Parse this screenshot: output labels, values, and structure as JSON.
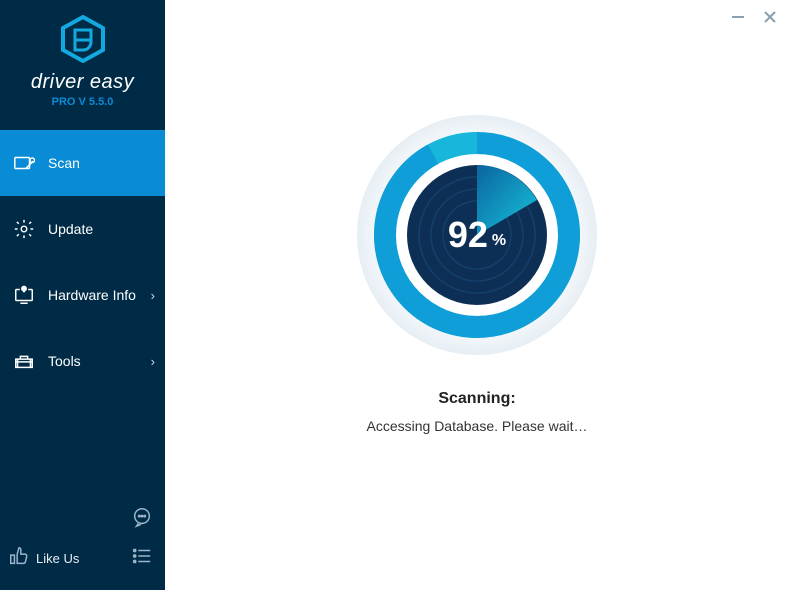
{
  "app": {
    "name": "driver easy",
    "version_label": "PRO V 5.5.0"
  },
  "sidebar": {
    "items": [
      {
        "label": "Scan",
        "has_chevron": false,
        "active": true
      },
      {
        "label": "Update",
        "has_chevron": false,
        "active": false
      },
      {
        "label": "Hardware Info",
        "has_chevron": true,
        "active": false
      },
      {
        "label": "Tools",
        "has_chevron": true,
        "active": false
      }
    ],
    "like_label": "Like Us"
  },
  "scan": {
    "percent_value": "92",
    "percent_symbol": "%",
    "title": "Scanning:",
    "message": "Accessing Database. Please wait…"
  },
  "colors": {
    "sidebar_bg": "#002b46",
    "accent": "#0a8bd6",
    "ring_outer": "#17b6da",
    "ring_inner_dark": "#0d2f55"
  }
}
